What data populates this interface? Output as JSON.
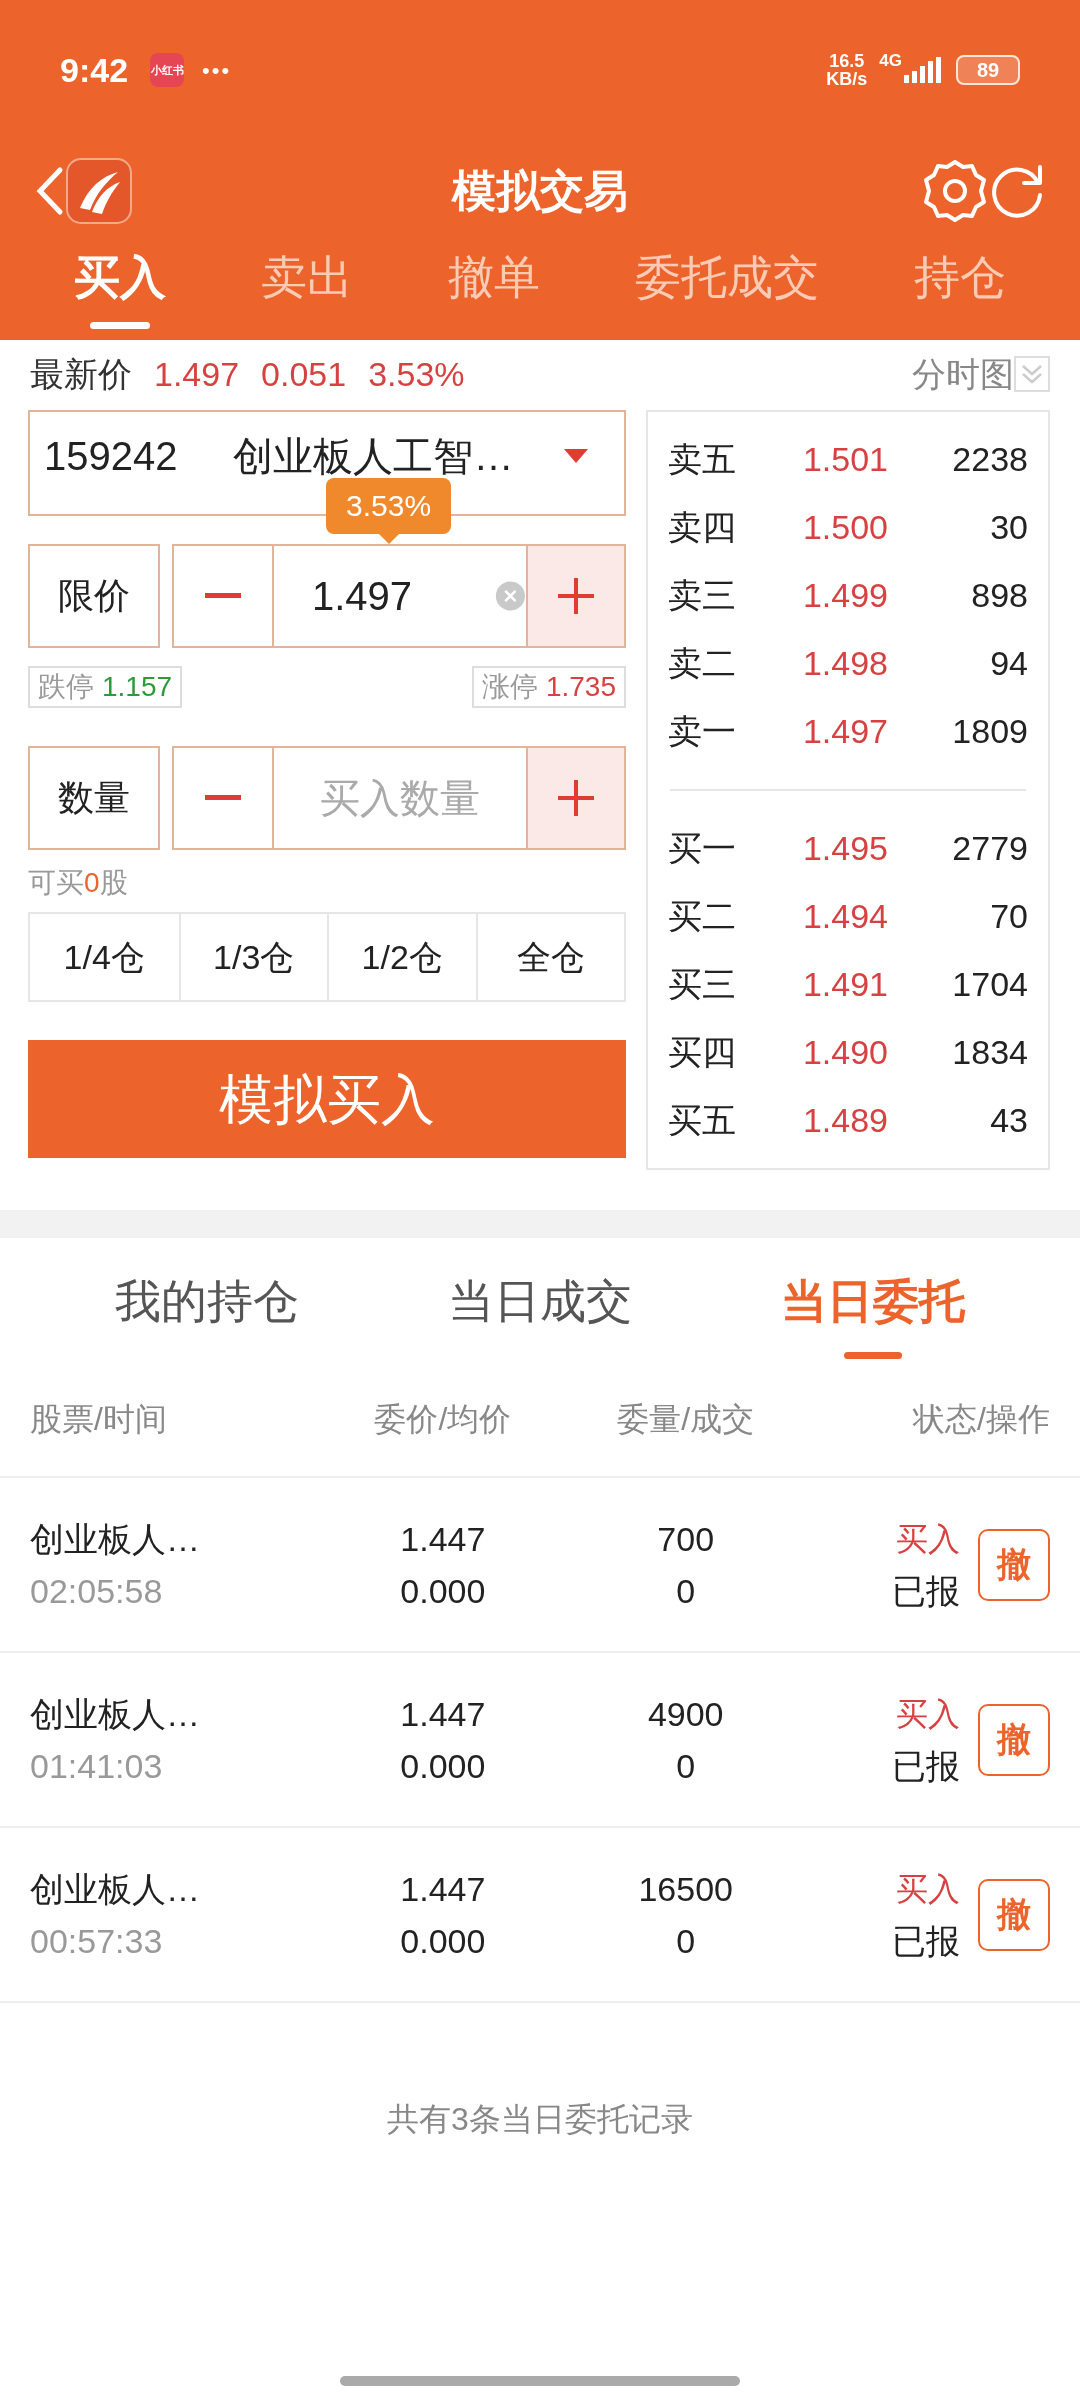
{
  "status_bar": {
    "time": "9:42",
    "app_badge": "小红书",
    "dots": "•••",
    "net_speed": "16.5",
    "net_unit": "KB/s",
    "net_type": "4G",
    "battery": "89"
  },
  "header": {
    "title": "模拟交易"
  },
  "tabs": [
    {
      "label": "买入",
      "selected": true
    },
    {
      "label": "卖出",
      "selected": false
    },
    {
      "label": "撤单",
      "selected": false
    },
    {
      "label": "委托成交",
      "selected": false
    },
    {
      "label": "持仓",
      "selected": false
    }
  ],
  "quote": {
    "label": "最新价",
    "price": "1.497",
    "change": "0.051",
    "percent": "3.53%",
    "chart_toggle": "分时图"
  },
  "stock": {
    "code": "159242",
    "name": "创业板人工智…",
    "tooltip": "3.53%"
  },
  "price_field": {
    "label": "限价",
    "value": "1.497"
  },
  "limits": {
    "down_label": "跌停",
    "down_value": "1.157",
    "up_label": "涨停",
    "up_value": "1.735"
  },
  "quantity_field": {
    "label": "数量",
    "placeholder": "买入数量"
  },
  "available": {
    "prefix": "可买",
    "count": "0",
    "suffix": "股"
  },
  "position_buttons": [
    "1/4仓",
    "1/3仓",
    "1/2仓",
    "全仓"
  ],
  "buy_button": "模拟买入",
  "order_book": {
    "asks": [
      {
        "level": "卖五",
        "price": "1.501",
        "volume": "2238"
      },
      {
        "level": "卖四",
        "price": "1.500",
        "volume": "30"
      },
      {
        "level": "卖三",
        "price": "1.499",
        "volume": "898"
      },
      {
        "level": "卖二",
        "price": "1.498",
        "volume": "94"
      },
      {
        "level": "卖一",
        "price": "1.497",
        "volume": "1809"
      }
    ],
    "bids": [
      {
        "level": "买一",
        "price": "1.495",
        "volume": "2779"
      },
      {
        "level": "买二",
        "price": "1.494",
        "volume": "70"
      },
      {
        "level": "买三",
        "price": "1.491",
        "volume": "1704"
      },
      {
        "level": "买四",
        "price": "1.490",
        "volume": "1834"
      },
      {
        "level": "买五",
        "price": "1.489",
        "volume": "43"
      }
    ]
  },
  "bottom_tabs": [
    {
      "label": "我的持仓",
      "selected": false
    },
    {
      "label": "当日成交",
      "selected": false
    },
    {
      "label": "当日委托",
      "selected": true
    }
  ],
  "columns": [
    "股票/时间",
    "委价/均价",
    "委量/成交",
    "状态/操作"
  ],
  "orders": [
    {
      "name": "创业板人…",
      "time": "02:05:58",
      "price": "1.447",
      "avg_price": "0.000",
      "quantity": "700",
      "filled": "0",
      "side": "买入",
      "status": "已报",
      "action": "撤"
    },
    {
      "name": "创业板人…",
      "time": "01:41:03",
      "price": "1.447",
      "avg_price": "0.000",
      "quantity": "4900",
      "filled": "0",
      "side": "买入",
      "status": "已报",
      "action": "撤"
    },
    {
      "name": "创业板人…",
      "time": "00:57:33",
      "price": "1.447",
      "avg_price": "0.000",
      "quantity": "16500",
      "filled": "0",
      "side": "买入",
      "status": "已报",
      "action": "撤"
    }
  ],
  "footer": "共有3条当日委托记录"
}
